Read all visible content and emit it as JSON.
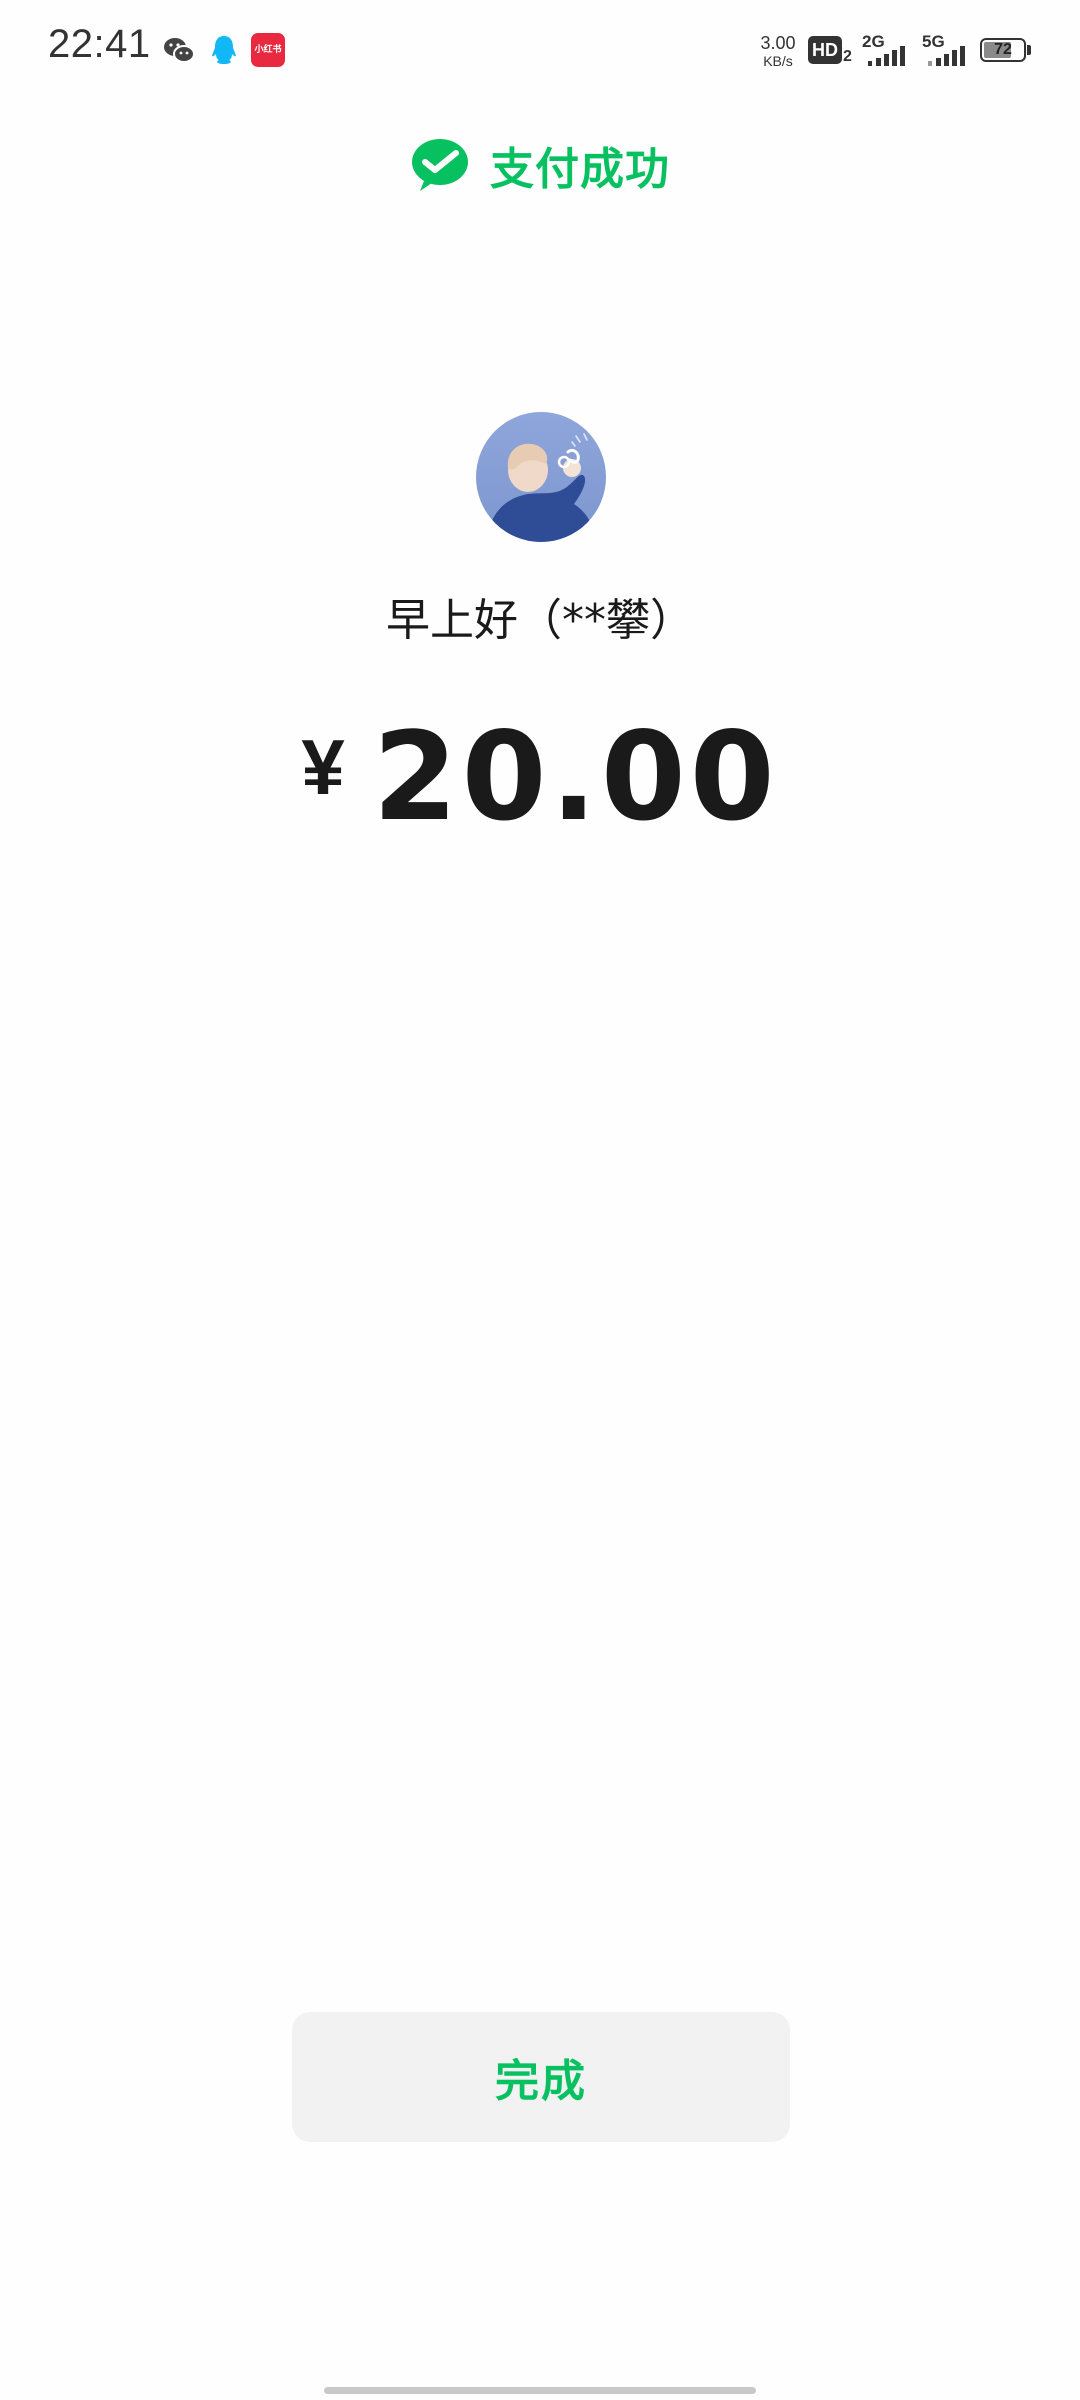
{
  "status_bar": {
    "time": "22:41",
    "net_speed_value": "3.00",
    "net_speed_unit": "KB/s",
    "hd_badge": "HD",
    "hd_sub": "2",
    "signal_1_label": "2G",
    "signal_2_label": "5G",
    "battery_level": "72",
    "battery_fraction": 0.72,
    "notification_icons": [
      "wechat-icon",
      "qq-icon",
      "xiaohongshu-icon"
    ],
    "xiaohongshu_label": "小红书"
  },
  "header": {
    "title": "支付成功",
    "icon": "wechat-pay-check-icon"
  },
  "payee": {
    "name": "早上好（**攀）"
  },
  "amount": {
    "currency": "¥",
    "value": "20.00"
  },
  "actions": {
    "done_label": "完成"
  },
  "colors": {
    "brand_green": "#07c160",
    "text_dark": "#1a1a1a",
    "button_bg": "#f2f2f2",
    "page_bg": "#fefefe"
  }
}
